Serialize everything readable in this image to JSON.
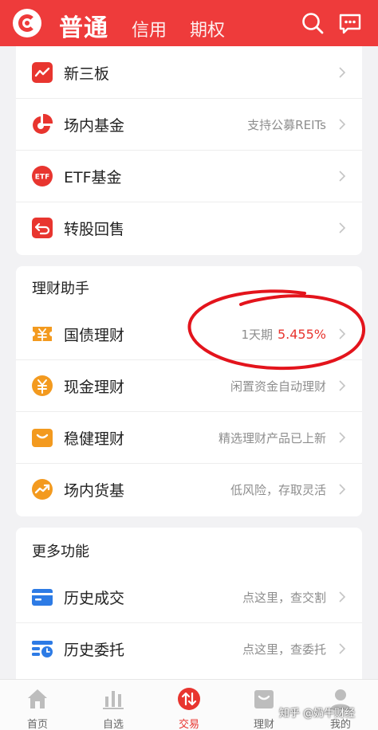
{
  "header": {
    "tab_active": "普通",
    "tab_credit": "信用",
    "tab_options": "期权",
    "brand_color": "#ee3b3b"
  },
  "trade_list": [
    {
      "label": "新三板",
      "sub": "",
      "icon": "trend-chart-icon"
    },
    {
      "label": "场内基金",
      "sub": "支持公募REITs",
      "icon": "pie-chart-icon"
    },
    {
      "label": "ETF基金",
      "sub": "",
      "icon": "etf-icon",
      "icon_text": "ETF"
    },
    {
      "label": "转股回售",
      "sub": "",
      "icon": "return-arrow-icon"
    }
  ],
  "wealth": {
    "title": "理财助手",
    "items": [
      {
        "label": "国债理财",
        "sub": "1天期",
        "rate": "5.455%",
        "icon": "ticket-yen-icon"
      },
      {
        "label": "现金理财",
        "sub": "闲置资金自动理财",
        "icon": "yen-coin-icon"
      },
      {
        "label": "稳健理财",
        "sub": "精选理财产品已上新",
        "icon": "bag-icon"
      },
      {
        "label": "场内货基",
        "sub": "低风险，存取灵活",
        "icon": "trend-up-coin-icon"
      }
    ]
  },
  "more": {
    "title": "更多功能",
    "items": [
      {
        "label": "历史成交",
        "sub": "点这里，查交割",
        "icon": "calendar-card-icon"
      },
      {
        "label": "历史委托",
        "sub": "点这里，查委托",
        "icon": "list-clock-icon"
      }
    ]
  },
  "tabbar": [
    {
      "label": "首页",
      "icon": "home-icon"
    },
    {
      "label": "自选",
      "icon": "bar-chart-icon"
    },
    {
      "label": "交易",
      "icon": "trade-arrows-icon"
    },
    {
      "label": "理财",
      "icon": "wallet-icon"
    },
    {
      "label": "我的",
      "icon": "person-icon"
    }
  ],
  "watermark": "知乎 @奶牛财经",
  "colors": {
    "accent": "#e8352f",
    "icon_blue": "#2d7be5",
    "icon_orange": "#f39a1f"
  }
}
